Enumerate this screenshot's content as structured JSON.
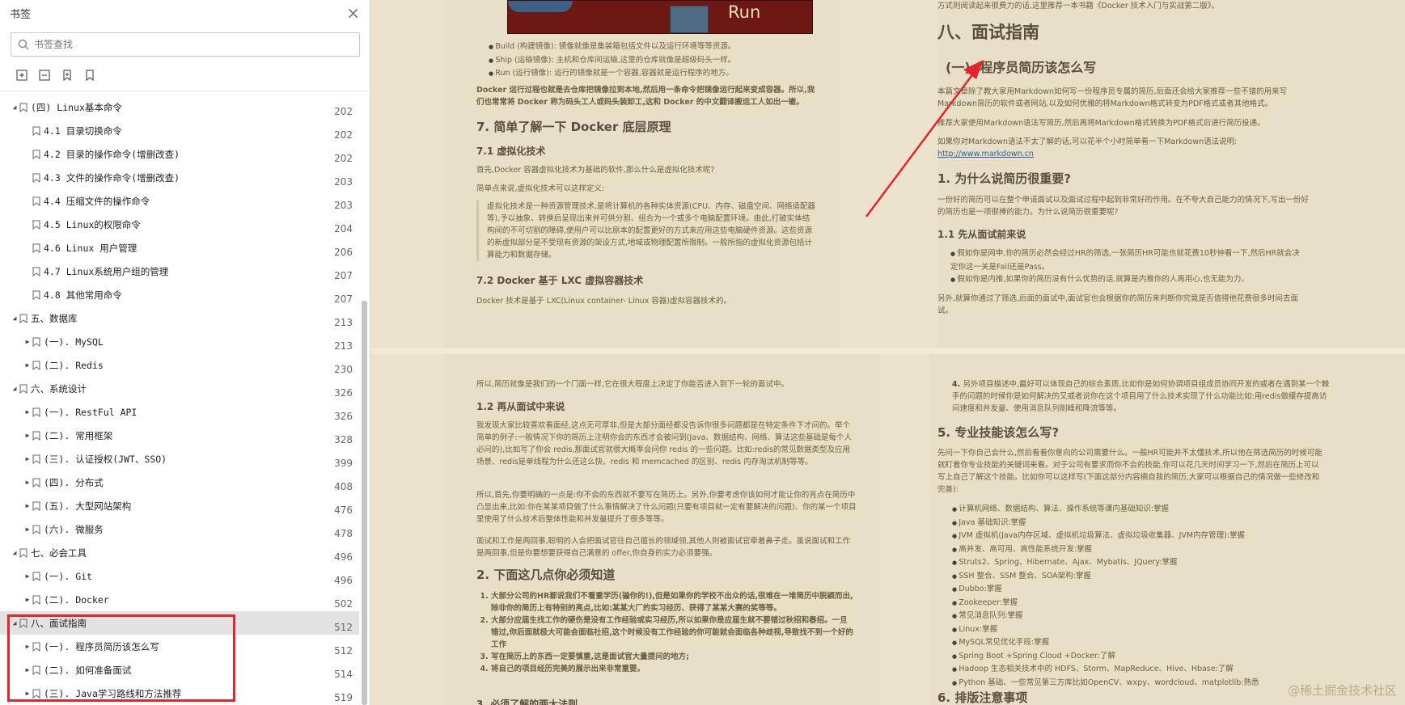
{
  "sidebar": {
    "title": "书签",
    "close_glyph": "×",
    "search_placeholder": "书签查找",
    "tools": [
      "expand-all-icon",
      "collapse-all-icon",
      "add-bookmark-icon",
      "bookmark-icon"
    ],
    "items": [
      {
        "level": 1,
        "expanded": true,
        "label": "(四) Linux基本命令",
        "page": "202"
      },
      {
        "level": 2,
        "expanded": null,
        "label": "4.1 目录切换命令",
        "page": "202"
      },
      {
        "level": 2,
        "expanded": null,
        "label": "4.2 目录的操作命令(增删改查)",
        "page": "202"
      },
      {
        "level": 2,
        "expanded": null,
        "label": "4.3 文件的操作命令(增删改查)",
        "page": "203"
      },
      {
        "level": 2,
        "expanded": null,
        "label": "4.4 压缩文件的操作命令",
        "page": "203"
      },
      {
        "level": 2,
        "expanded": null,
        "label": "4.5 Linux的权限命令",
        "page": "204"
      },
      {
        "level": 2,
        "expanded": null,
        "label": "4.6 Linux 用户管理",
        "page": "206"
      },
      {
        "level": 2,
        "expanded": null,
        "label": "4.7 Linux系统用户组的管理",
        "page": "207"
      },
      {
        "level": 2,
        "expanded": null,
        "label": "4.8 其他常用命令",
        "page": "207"
      },
      {
        "level": 1,
        "expanded": true,
        "label": "五、数据库",
        "page": "213"
      },
      {
        "level": 2,
        "expanded": false,
        "label": "(一). MySQL",
        "page": "213"
      },
      {
        "level": 2,
        "expanded": false,
        "label": "(二). Redis",
        "page": "230"
      },
      {
        "level": 1,
        "expanded": true,
        "label": "六、系统设计",
        "page": "326"
      },
      {
        "level": 2,
        "expanded": false,
        "label": "(一). RestFul API",
        "page": "326"
      },
      {
        "level": 2,
        "expanded": false,
        "label": "(二). 常用框架",
        "page": "328"
      },
      {
        "level": 2,
        "expanded": false,
        "label": "(三). 认证授权(JWT、SSO)",
        "page": "399"
      },
      {
        "level": 2,
        "expanded": false,
        "label": "(四). 分布式",
        "page": "408"
      },
      {
        "level": 2,
        "expanded": false,
        "label": "(五). 大型网站架构",
        "page": "476"
      },
      {
        "level": 2,
        "expanded": false,
        "label": "(六). 微服务",
        "page": "478"
      },
      {
        "level": 1,
        "expanded": true,
        "label": "七、必会工具",
        "page": "496"
      },
      {
        "level": 2,
        "expanded": false,
        "label": "(一). Git",
        "page": "496"
      },
      {
        "level": 2,
        "expanded": false,
        "label": "(二). Docker",
        "page": "502"
      },
      {
        "level": 1,
        "expanded": true,
        "label": "八、面试指南",
        "page": "512",
        "selected": true
      },
      {
        "level": 2,
        "expanded": false,
        "label": "(一). 程序员简历该怎么写",
        "page": "512"
      },
      {
        "level": 2,
        "expanded": false,
        "label": "(二). 如何准备面试",
        "page": "514"
      },
      {
        "level": 2,
        "expanded": false,
        "label": "(三). Java学习路线和方法推荐",
        "page": "519"
      }
    ]
  },
  "doc": {
    "p1": {
      "run_text": "Run",
      "bullets": [
        "Build (构建镜像): 镜像就像是集装箱包括文件以及运行环境等等资源。",
        "Ship (运输镜像): 主机和仓库间运输,这里的仓库就像是超级码头一样。",
        "Run (运行镜像): 运行的镜像就是一个容器,容器就是运行程序的地方。"
      ],
      "para1": "Docker 运行过程也就是去仓库把镜像拉到本地,然后用一条命令把镜像运行起来变成容器。所以,我们也常常将 Docker 称为码头工人或码头装卸工,这和 Docker 的中文翻译搬运工人如出一辙。",
      "h7": "7. 简单了解一下 Docker 底层原理",
      "h71": "7.1 虚拟化技术",
      "para2": "首先,Docker 容器虚拟化技术为基础的软件,那么什么是虚拟化技术呢?",
      "para3": "简单点来说,虚拟化技术可以这样定义:",
      "quote": "虚拟化技术是一种资源管理技术,是将计算机的各种实体资源(CPU、内存、磁盘空间、网络适配器等),予以抽象、转换后呈现出来并可供分割、组合为一个或多个电脑配置环境。由此,打破实体结构间的不可切割的障碍,使用户可以比原本的配置更好的方式来应用这些电脑硬件资源。这些资源的新虚拟部分是不受现有资源的架设方式,地域或物理配置所限制。一般所指的虚拟化资源包括计算能力和数据存储。",
      "h72": "7.2 Docker 基于 LXC 虚拟容器技术",
      "para4": "Docker 技术是基于 LXC(Linux container- Linux 容器)虚拟容器技术的。"
    },
    "p2": {
      "top_text": "方式则阅读起来很费力的话,这里推荐一本书籍《Docker 技术入门与实战第二版》。",
      "h8": "八、面试指南",
      "hsub": "(一). 程序员简历该怎么写",
      "para1": "本篇文章除了教大家用Markdown如何写一份程序员专属的简历,后面还会给大家推荐一些不错的用来写Markdown简历的软件或者网站,以及如何优雅的将Markdown格式转变为PDF格式或者其他格式。",
      "para2": "推荐大家使用Markdown语法写简历,然后再将Markdown格式转换为PDF格式后进行简历投递。",
      "para3": "如果你对Markdown语法不太了解的话,可以花半个小时简单看一下Markdown语法说明:",
      "link": "http://www.markdown.cn",
      "h1": "1. 为什么说简历很重要?",
      "para4": "一份好的简历可以在整个申请面试以及面试过程中起到非常好的作用。在不夸大自己能力的情况下,写出一份好的简历也是一项很棒的能力。为什么说简历很重要呢?",
      "h11": "1.1 先从面试前来说",
      "bullets": [
        "假如你是网申,你的简历必然会经过HR的筛选,一张简历HR可能也就花费10秒钟看一下,然后HR就会决定你这一关是Fail还是Pass。",
        "假如你是内推,如果你的简历没有什么优势的话,就算是内推你的人再用心,也无能为力。"
      ],
      "para5": "另外,就算你通过了筛选,后面的面试中,面试官也会根据你的简历来判断你究竟是否值得他花费很多时间去面试。"
    },
    "p3": {
      "para1": "所以,简历就像是我们的一个门面一样,它在很大程度上决定了你能否进入到下一轮的面试中。",
      "h12": "1.2 再从面试中来说",
      "para2": "我发现大家比较喜欢看面经,这点无可厚非,但是大部分面经都没告诉你很多问题都是在特定条件下才问的。举个简单的例子:一般情况下你的简历上注明你会的东西才会被问到(Java、数据结构、网络、算法这些基础是每个人必问的),比如写了你会 redis,那面试官就很大概率会问你 redis 的一些问题。比如:redis的常见数据类型及应用场景、redis是单线程为什么还这么快、redis 和 memcached 的区别、redis 内存淘汰机制等等。",
      "para3": "所以,首先,你要明确的一点是:你不会的东西就不要写在简历上。另外,你要考虑你该如何才能让你的亮点在简历中凸显出来,比如:你在某某项目做了什么事情解决了什么问题(只要有项目就一定有要解决的问题)、你的某一个项目里使用了什么技术后整体性能和并发量提升了很多等等。",
      "para4": "面试和工作是两回事,聪明的人会把面试官往自己擅长的领域领,其他人则被面试官牵着鼻子走。虽说面试和工作是两回事,但是你要想要获得自己满意的 offer,你自身的实力必须要强。",
      "h2": "2. 下面这几点你必须知道",
      "list": [
        "大部分公司的HR都说我们不看重学历(骗你的!),但是如果你的学校不出众的话,很难在一堆简历中脱颖而出,除非你的简历上有特别的亮点,比如:某某大厂的实习经历、获得了某某大赛的奖等等。",
        "大部分应届生找工作的硬伤是没有工作经验或实习经历,所以如果你是应届生就不要错过秋招和春招。一旦错过,你后面就极大可能会面临社招,这个时候没有工作经验的你可能就会面临各种歧视,导致找不到一个好的工作",
        "写在简历上的东西一定要慎重,这是面试官大量提问的地方;",
        "将自己的项目经历完美的展示出来非常重要。"
      ],
      "bottom": "3. 必须了解的两大法则"
    },
    "p4": {
      "item4": "另外项目描述中,最好可以体现自己的综合素质,比如你是如何协调项目组成员协同开发的或者在遇到某一个棘手的问题的时候你是如何解决的又或者说你在这个项目用了什么技术实现了什么功能比如:用redis做缓存提高访问速度和并发量、使用消息队列削峰和降流等等。",
      "h5": "5. 专业技能该怎么写?",
      "para1": "先问一下你自己会什么,然后看看你意向的公司需要什么。一般HR可能并不太懂技术,所以他在筛选简历的时候可能就盯着你专业技能的关键词来看。对于公司有要求而你不会的技能,你可以花几天时间学习一下,然后在简历上可以写上自己了解这个技能。比如你可以这样写(下面这部分内容摘自我的简历,大家可以根据自己的情况做一些修改和完善):",
      "skills": [
        "计算机网络、数据结构、算法、操作系统等课内基础知识:掌握",
        "Java 基础知识:掌握",
        "JVM 虚拟机(Java内存区域、虚拟机垃圾算法、虚拟垃圾收集器、JVM内存管理):掌握",
        "高并发、高可用、高性能系统开发:掌握",
        "Struts2、Spring、Hibernate、Ajax、Mybatis、JQuery:掌握",
        "SSH 整合、SSM 整合、SOA架构:掌握",
        "Dubbo:掌握",
        "Zookeeper:掌握",
        "常见消息队列:掌握",
        "Linux:掌握",
        "MySQL常见优化手段:掌握",
        "Spring Boot +Spring Cloud +Docker:了解",
        "Hadoop 生态相关技术中的 HDFS、Storm、MapReduce、Hive、Hbase:了解",
        "Python 基础、一些常见第三方库比如OpenCV、wxpy、wordcloud、matplotlib:熟悉"
      ],
      "h6": "6. 排版注意事项"
    },
    "watermark": "@稀土掘金技术社区"
  },
  "colors": {
    "highlight_box": "#e3242b",
    "arrow": "#e3242b",
    "page_bg": "#ece3cc",
    "link": "#2c5fa8"
  }
}
